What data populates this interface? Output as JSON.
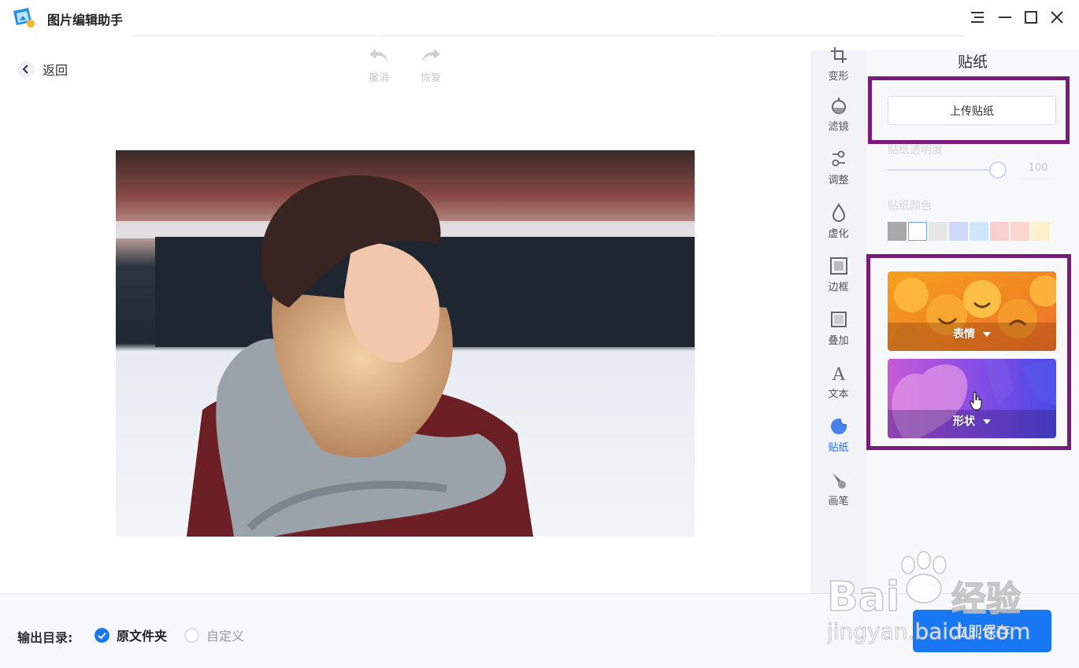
{
  "app": {
    "title": "图片编辑助手"
  },
  "window_controls": {
    "menu_icon": "menu-icon",
    "minimize_icon": "minimize-icon",
    "maximize_icon": "maximize-icon",
    "close_icon": "close-icon"
  },
  "toolbar": {
    "back_label": "返回",
    "undo_label": "撤消",
    "redo_label": "恢复"
  },
  "tools": [
    {
      "label": "变形",
      "icon": "crop-icon"
    },
    {
      "label": "滤镜",
      "icon": "filter-icon"
    },
    {
      "label": "调整",
      "icon": "adjust-icon"
    },
    {
      "label": "虚化",
      "icon": "blur-icon"
    },
    {
      "label": "边框",
      "icon": "border-icon"
    },
    {
      "label": "叠加",
      "icon": "overlay-icon"
    },
    {
      "label": "文本",
      "icon": "text-icon"
    },
    {
      "label": "贴纸",
      "icon": "sticker-icon",
      "active": true
    },
    {
      "label": "画笔",
      "icon": "brush-icon"
    }
  ],
  "panel": {
    "title": "贴纸",
    "upload_label": "上传贴纸",
    "opacity_label": "贴纸透明度",
    "opacity_value": "100",
    "opacity_fraction": 1.0,
    "color_label": "贴纸颜色",
    "colors": [
      "#a9a9a9",
      "#ffffff",
      "#e6e6e6",
      "#cdd8fb",
      "#cfe6fb",
      "#f9cfcf",
      "#fbd6cc",
      "#fbf1cd"
    ],
    "categories": [
      {
        "label": "表情"
      },
      {
        "label": "形状"
      }
    ]
  },
  "footer": {
    "output_label": "输出目录:",
    "option_original": "原文件夹",
    "option_custom": "自定义",
    "save_label": "立即保存"
  },
  "watermark": {
    "line1": "Bai",
    "line1b": "经验",
    "line2": "jingyan.baidu.com"
  },
  "accent": "#1877f2",
  "highlight_color": "#7a1a7a"
}
